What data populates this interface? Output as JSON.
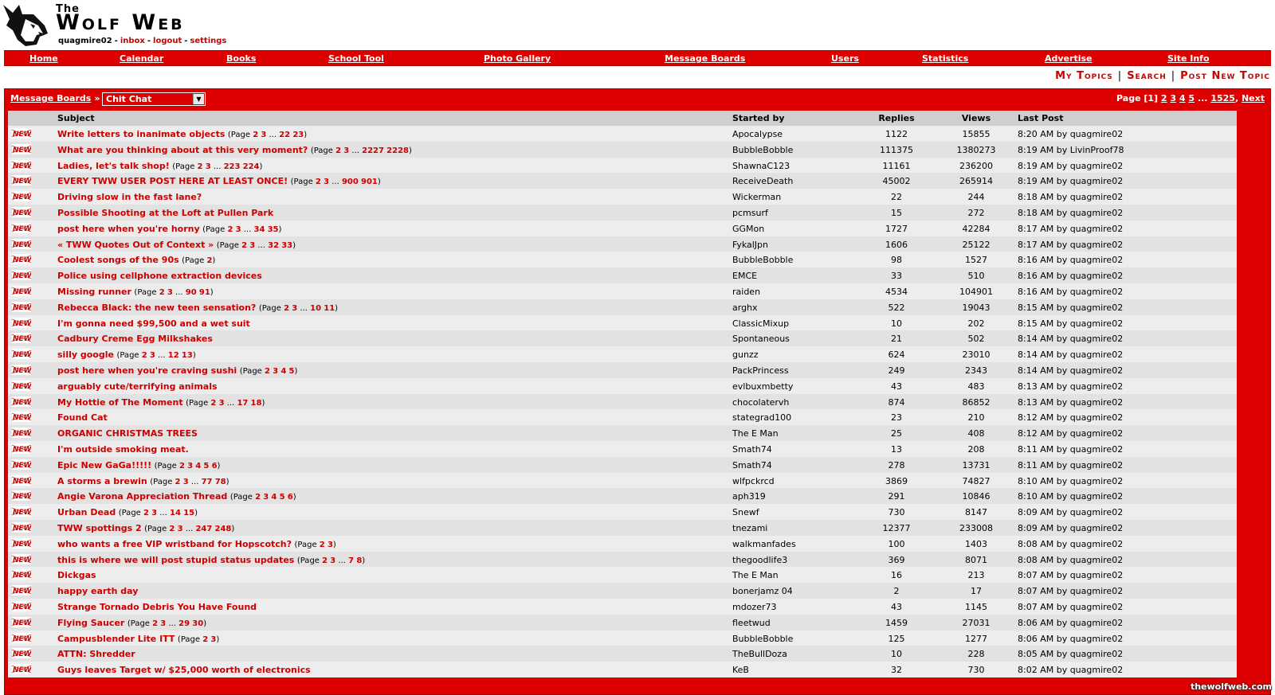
{
  "site": {
    "title_small": "The",
    "title_big": "Wolf Web",
    "username": "quagmire02",
    "inbox": "inbox",
    "logout": "logout",
    "settings": "settings",
    "watermark": "thewolfweb.com"
  },
  "nav": [
    "Home",
    "Calendar",
    "Books",
    "School Tool",
    "Photo Gallery",
    "Message Boards",
    "Users",
    "Statistics",
    "Advertise",
    "Site Info"
  ],
  "actions": {
    "my_topics": "My Topics",
    "search": "Search",
    "post_new_topic": "Post New Topic",
    "separator": "|"
  },
  "board": {
    "breadcrumb": "Message Boards",
    "raquo": "»",
    "selected_board": "Chit Chat",
    "paging": {
      "label": "Page [1]",
      "pages": [
        "2",
        "3",
        "4",
        "5"
      ],
      "ellipsis": "...",
      "last": "1525",
      "comma": ",",
      "next": "Next"
    }
  },
  "columns": {
    "subject": "Subject",
    "started_by": "Started by",
    "replies": "Replies",
    "views": "Views",
    "last_post": "Last Post"
  },
  "colors": {
    "brand_red": "#dd0000",
    "link_red": "#cc0000",
    "row_light": "#ededed",
    "row_dark": "#e2e2e2"
  },
  "icon": "new-topic-icon",
  "topics": [
    {
      "subject": "Write letters to inanimate objects",
      "pages": "(Page 2 3 ... 22 23)",
      "starter": "Apocalypse",
      "replies": "1122",
      "views": "15855",
      "last": "8:20 AM by quagmire02"
    },
    {
      "subject": "What are you thinking about at this very moment?",
      "pages": "(Page 2 3 ... 2227 2228)",
      "starter": "BubbleBobble",
      "replies": "111375",
      "views": "1380273",
      "last": "8:19 AM by LivinProof78"
    },
    {
      "subject": "Ladies, let's talk shop!",
      "pages": "(Page 2 3 ... 223 224)",
      "starter": "ShawnaC123",
      "replies": "11161",
      "views": "236200",
      "last": "8:19 AM by quagmire02"
    },
    {
      "subject": "EVERY TWW USER POST HERE AT LEAST ONCE!",
      "pages": "(Page 2 3 ... 900 901)",
      "starter": "ReceiveDeath",
      "replies": "45002",
      "views": "265914",
      "last": "8:19 AM by quagmire02"
    },
    {
      "subject": "Driving slow in the fast lane?",
      "pages": "",
      "starter": "Wickerman",
      "replies": "22",
      "views": "244",
      "last": "8:18 AM by quagmire02"
    },
    {
      "subject": "Possible Shooting at the Loft at Pullen Park",
      "pages": "",
      "starter": "pcmsurf",
      "replies": "15",
      "views": "272",
      "last": "8:18 AM by quagmire02"
    },
    {
      "subject": "post here when you're horny",
      "pages": "(Page 2 3 ... 34 35)",
      "starter": "GGMon",
      "replies": "1727",
      "views": "42284",
      "last": "8:17 AM by quagmire02"
    },
    {
      "subject": "« TWW Quotes Out of Context »",
      "pages": "(Page 2 3 ... 32 33)",
      "starter": "FykalJpn",
      "replies": "1606",
      "views": "25122",
      "last": "8:17 AM by quagmire02"
    },
    {
      "subject": "Coolest songs of the 90s",
      "pages": "(Page 2)",
      "starter": "BubbleBobble",
      "replies": "98",
      "views": "1527",
      "last": "8:16 AM by quagmire02"
    },
    {
      "subject": "Police using cellphone extraction devices",
      "pages": "",
      "starter": "EMCE",
      "replies": "33",
      "views": "510",
      "last": "8:16 AM by quagmire02"
    },
    {
      "subject": "Missing runner",
      "pages": "(Page 2 3 ... 90 91)",
      "starter": "raiden",
      "replies": "4534",
      "views": "104901",
      "last": "8:16 AM by quagmire02"
    },
    {
      "subject": "Rebecca Black: the new teen sensation?",
      "pages": "(Page 2 3 ... 10 11)",
      "starter": "arghx",
      "replies": "522",
      "views": "19043",
      "last": "8:15 AM by quagmire02"
    },
    {
      "subject": "I'm gonna need $99,500 and a wet suit",
      "pages": "",
      "starter": "ClassicMixup",
      "replies": "10",
      "views": "202",
      "last": "8:15 AM by quagmire02"
    },
    {
      "subject": "Cadbury Creme Egg Milkshakes",
      "pages": "",
      "starter": "Spontaneous",
      "replies": "21",
      "views": "502",
      "last": "8:14 AM by quagmire02"
    },
    {
      "subject": "silly google",
      "pages": "(Page 2 3 ... 12 13)",
      "starter": "gunzz",
      "replies": "624",
      "views": "23010",
      "last": "8:14 AM by quagmire02"
    },
    {
      "subject": "post here when you're craving sushi",
      "pages": "(Page 2 3 4 5)",
      "starter": "PackPrincess",
      "replies": "249",
      "views": "2343",
      "last": "8:14 AM by quagmire02"
    },
    {
      "subject": "arguably cute/terrifying animals",
      "pages": "",
      "starter": "evlbuxmbetty",
      "replies": "43",
      "views": "483",
      "last": "8:13 AM by quagmire02"
    },
    {
      "subject": "My Hottie of The Moment",
      "pages": "(Page 2 3 ... 17 18)",
      "starter": "chocolatervh",
      "replies": "874",
      "views": "86852",
      "last": "8:13 AM by quagmire02"
    },
    {
      "subject": "Found Cat",
      "pages": "",
      "starter": "stategrad100",
      "replies": "23",
      "views": "210",
      "last": "8:12 AM by quagmire02"
    },
    {
      "subject": "ORGANIC CHRISTMAS TREES",
      "pages": "",
      "starter": "The E Man",
      "replies": "25",
      "views": "408",
      "last": "8:12 AM by quagmire02"
    },
    {
      "subject": "I'm outside smoking meat.",
      "pages": "",
      "starter": "Smath74",
      "replies": "13",
      "views": "208",
      "last": "8:11 AM by quagmire02"
    },
    {
      "subject": "Epic New GaGa!!!!!",
      "pages": "(Page 2 3 4 5 6)",
      "starter": "Smath74",
      "replies": "278",
      "views": "13731",
      "last": "8:11 AM by quagmire02"
    },
    {
      "subject": "A storms a brewin",
      "pages": "(Page 2 3 ... 77 78)",
      "starter": "wlfpckrcd",
      "replies": "3869",
      "views": "74827",
      "last": "8:10 AM by quagmire02"
    },
    {
      "subject": "Angie Varona Appreciation Thread",
      "pages": "(Page 2 3 4 5 6)",
      "starter": "aph319",
      "replies": "291",
      "views": "10846",
      "last": "8:10 AM by quagmire02"
    },
    {
      "subject": "Urban Dead",
      "pages": "(Page 2 3 ... 14 15)",
      "starter": "Snewf",
      "replies": "730",
      "views": "8147",
      "last": "8:09 AM by quagmire02"
    },
    {
      "subject": "TWW spottings 2",
      "pages": "(Page 2 3 ... 247 248)",
      "starter": "tnezami",
      "replies": "12377",
      "views": "233008",
      "last": "8:09 AM by quagmire02"
    },
    {
      "subject": "who wants a free VIP wristband for Hopscotch?",
      "pages": "(Page 2 3)",
      "starter": "walkmanfades",
      "replies": "100",
      "views": "1403",
      "last": "8:08 AM by quagmire02"
    },
    {
      "subject": "this is where we will post stupid status updates",
      "pages": "(Page 2 3 ... 7 8)",
      "starter": "thegoodlife3",
      "replies": "369",
      "views": "8071",
      "last": "8:08 AM by quagmire02"
    },
    {
      "subject": "Dickgas",
      "pages": "",
      "starter": "The E Man",
      "replies": "16",
      "views": "213",
      "last": "8:07 AM by quagmire02"
    },
    {
      "subject": "happy earth day",
      "pages": "",
      "starter": "bonerjamz 04",
      "replies": "2",
      "views": "17",
      "last": "8:07 AM by quagmire02"
    },
    {
      "subject": "Strange Tornado Debris You Have Found",
      "pages": "",
      "starter": "mdozer73",
      "replies": "43",
      "views": "1145",
      "last": "8:07 AM by quagmire02"
    },
    {
      "subject": "Flying Saucer",
      "pages": "(Page 2 3 ... 29 30)",
      "starter": "fleetwud",
      "replies": "1459",
      "views": "27031",
      "last": "8:06 AM by quagmire02"
    },
    {
      "subject": "Campusblender Lite ITT",
      "pages": "(Page 2 3)",
      "starter": "BubbleBobble",
      "replies": "125",
      "views": "1277",
      "last": "8:06 AM by quagmire02"
    },
    {
      "subject": "ATTN: Shredder",
      "pages": "",
      "starter": "TheBullDoza",
      "replies": "10",
      "views": "228",
      "last": "8:05 AM by quagmire02"
    },
    {
      "subject": "Guys leaves Target w/ $25,000 worth of electronics",
      "pages": "",
      "starter": "KeB",
      "replies": "32",
      "views": "730",
      "last": "8:02 AM by quagmire02"
    }
  ]
}
